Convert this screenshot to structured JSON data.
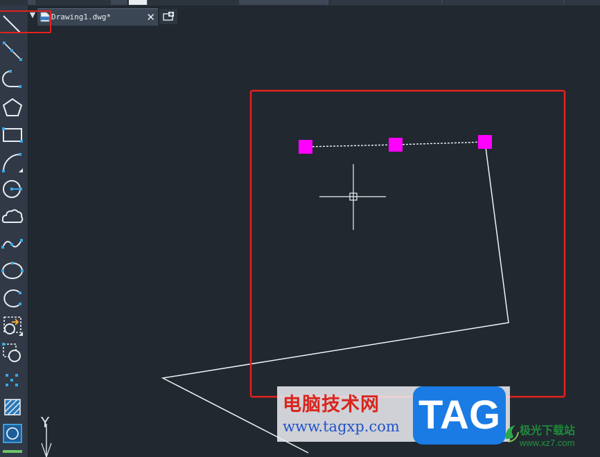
{
  "tab_bar": {
    "dropdown_glyph": "▼",
    "active_tab": {
      "title": "Drawing1.dwg*",
      "icon": "dwg-file-icon",
      "close_glyph": "✕"
    },
    "new_tab_icon": "new-tab-icon"
  },
  "toolbar": {
    "tools": [
      {
        "name": "line-tool",
        "icon": "line-icon",
        "highlighted": true
      },
      {
        "name": "construction-line-tool",
        "icon": "xline-icon"
      },
      {
        "name": "polyline-tool",
        "icon": "polyline-icon"
      },
      {
        "name": "polygon-tool",
        "icon": "polygon-icon"
      },
      {
        "name": "rectangle-tool",
        "icon": "rectangle-icon"
      },
      {
        "name": "arc-tool",
        "icon": "arc-icon"
      },
      {
        "name": "circle-tool",
        "icon": "circle-icon"
      },
      {
        "name": "revision-cloud-tool",
        "icon": "cloud-icon"
      },
      {
        "name": "spline-tool",
        "icon": "spline-icon"
      },
      {
        "name": "ellipse-tool",
        "icon": "ellipse-icon"
      },
      {
        "name": "ellipse-arc-tool",
        "icon": "ellipse-arc-icon"
      },
      {
        "name": "insert-block-tool",
        "icon": "insert-block-icon"
      },
      {
        "name": "make-block-tool",
        "icon": "make-block-icon"
      },
      {
        "name": "point-tool",
        "icon": "point-icon"
      },
      {
        "name": "hatch-tool",
        "icon": "hatch-icon"
      },
      {
        "name": "region-tool",
        "icon": "region-icon"
      }
    ]
  },
  "canvas": {
    "crosshair_icon": "crosshair-cursor-icon",
    "ucs_axis_label": "Y",
    "grip_color": "#ff00ff",
    "highlight_color": "#e5211d"
  },
  "watermark": {
    "site_name": "电脑技术网",
    "site_url": "www.tagxp.com",
    "tag_logo": "TAG",
    "xz_name": "极光下载站",
    "xz_url": "www.xz7.com"
  }
}
